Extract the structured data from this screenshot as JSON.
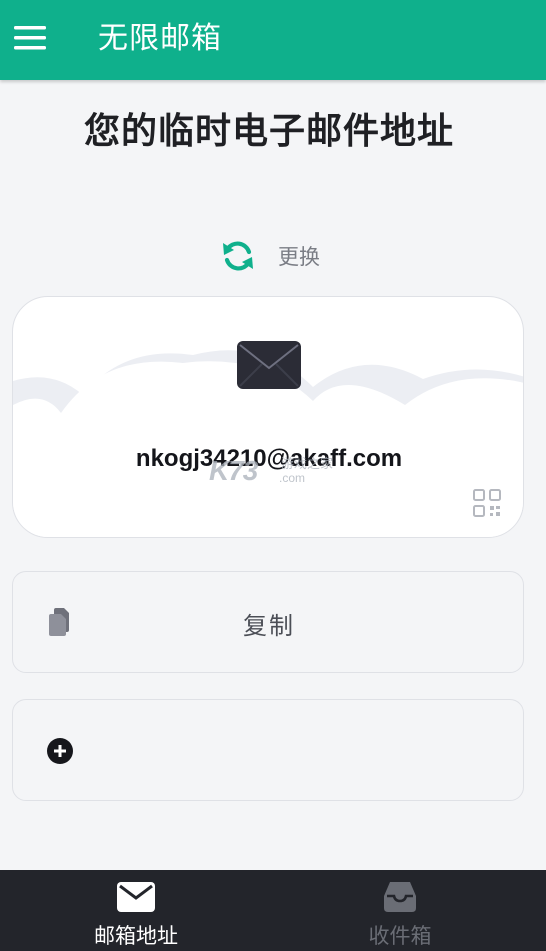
{
  "app_bar": {
    "title": "无限邮箱",
    "background": "#0fb08c"
  },
  "main": {
    "heading": "您的临时电子邮件地址",
    "refresh_label": "更换",
    "email_address": "nkogj34210@akaff.com",
    "copy_label": "复制"
  },
  "watermark": {
    "logo": "K73",
    "text": "游戏之家",
    "domain": ".com"
  },
  "bottom_nav": {
    "items": [
      {
        "label": "邮箱地址",
        "icon": "envelope-icon",
        "active": true
      },
      {
        "label": "收件箱",
        "icon": "inbox-icon",
        "active": false
      }
    ]
  },
  "colors": {
    "accent": "#0fb08c",
    "nav_bg": "#23252b",
    "text_dark": "#1f2024"
  }
}
